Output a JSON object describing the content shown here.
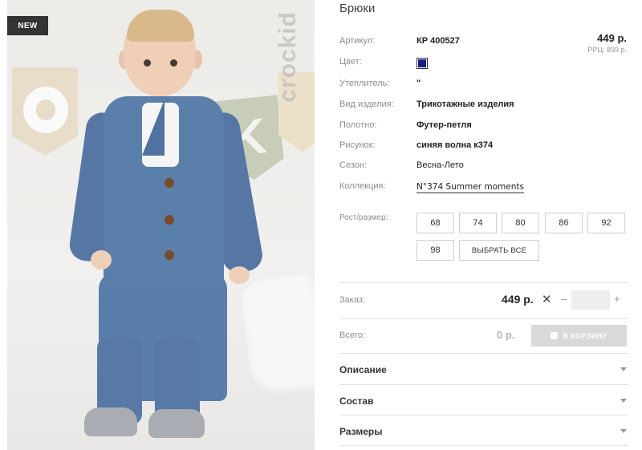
{
  "badge": {
    "new_label": "NEW"
  },
  "brand": {
    "watermark": "crockid"
  },
  "product": {
    "title": "Брюки",
    "price": "449 р.",
    "rrp": "РРЦ: 899 р.",
    "details": [
      {
        "label": "Артикул:",
        "value": "КР 400527"
      },
      {
        "label": "Цвет:",
        "value": ""
      },
      {
        "label": "Утеплитель:",
        "value": "\""
      },
      {
        "label": "Вид изделия:",
        "value": "Трикотажные изделия"
      },
      {
        "label": "Полотно:",
        "value": "Футер-петля"
      },
      {
        "label": "Рисунок:",
        "value": "синяя волна к374"
      },
      {
        "label": "Сезон:",
        "value": "Весна-Лето"
      },
      {
        "label": "Коллекция:",
        "value": "N°374 Summer moments"
      }
    ],
    "color_swatch": "#1c1c8a"
  },
  "sizes": {
    "label": "Рост/размер:",
    "options": [
      "68",
      "74",
      "80",
      "86",
      "92",
      "98"
    ],
    "select_all": "ВЫБРАТЬ ВСЕ"
  },
  "order": {
    "label": "Заказ:",
    "unit_price": "449 р.",
    "times": "✕",
    "minus": "–",
    "plus": "+",
    "quantity": ""
  },
  "total": {
    "label": "Всего:",
    "value": "0 р.",
    "cart_button": "В КОРЗИНУ"
  },
  "accordion": [
    {
      "title": "Описание"
    },
    {
      "title": "Состав"
    },
    {
      "title": "Размеры"
    }
  ]
}
